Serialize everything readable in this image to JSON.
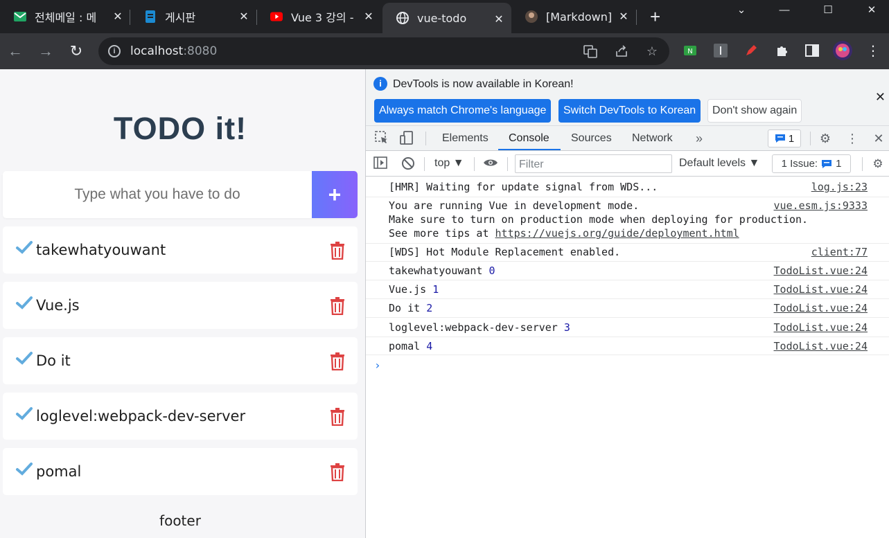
{
  "tabs": [
    {
      "title": "전체메일 : 메",
      "color": "#1fa463"
    },
    {
      "title": "게시판",
      "color": "#1b8ad1"
    },
    {
      "title": "Vue 3 강의 -",
      "color": "#ff0000"
    },
    {
      "title": "vue-todo",
      "color": "#e8eaed"
    },
    {
      "title": "[Markdown]",
      "color": "#8a6c5a"
    }
  ],
  "address": {
    "host": "localhost",
    "port": ":8080"
  },
  "app": {
    "title": "TODO it!",
    "input_placeholder": "Type what you have to do",
    "add_label": "+",
    "todos": [
      "takewhatyouwant",
      "Vue.js",
      "Do it",
      "loglevel:webpack-dev-server",
      "pomal"
    ],
    "footer": "footer"
  },
  "devtools": {
    "info_message": "DevTools is now available in Korean!",
    "btn_match": "Always match Chrome's language",
    "btn_switch": "Switch DevTools to Korean",
    "btn_dont": "Don't show again",
    "tabs": [
      "Elements",
      "Console",
      "Sources",
      "Network"
    ],
    "active_tab": "Console",
    "message_count": "1",
    "context": "top",
    "filter_placeholder": "Filter",
    "levels": "Default levels",
    "issue_label": "1 Issue:",
    "issue_count": "1",
    "logs": [
      {
        "text": "[HMR] Waiting for update signal from WDS...",
        "src": "log.js:23"
      },
      {
        "text": "You are running Vue in development mode.",
        "text2": "Make sure to turn on production mode when deploying for production.",
        "text3": "See more tips at ",
        "link": "https://vuejs.org/guide/deployment.html",
        "src": "vue.esm.js:9333"
      },
      {
        "text": "[WDS] Hot Module Replacement enabled.",
        "src": "client:77"
      },
      {
        "text": "takewhatyouwant",
        "num": "0",
        "src": "TodoList.vue:24"
      },
      {
        "text": "Vue.js",
        "num": "1",
        "src": "TodoList.vue:24"
      },
      {
        "text": "Do it",
        "num": "2",
        "src": "TodoList.vue:24"
      },
      {
        "text": "loglevel:webpack-dev-server",
        "num": "3",
        "src": "TodoList.vue:24"
      },
      {
        "text": "pomal",
        "num": "4",
        "src": "TodoList.vue:24"
      }
    ]
  }
}
